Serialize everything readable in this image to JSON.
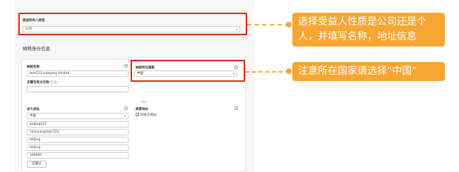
{
  "beneficial_owner": {
    "label": "受益所有人类型",
    "value": "公司"
  },
  "tax_section": {
    "title": "纳税身份信息"
  },
  "tax_form": {
    "name_label": "纳税名称",
    "name_value": "test123 company limited",
    "country_label": "纳税所在国家",
    "country_value": "中国",
    "english_name_label": "无需写英文名称",
    "english_name_hint": "(可选)",
    "address_section_label": "地址",
    "perm_address_label": "永久地址",
    "perm_country_value": "中国",
    "address_lines": [
      "beijing123",
      "chaoyangdajie123",
      "beijing",
      "beijing",
      "100000"
    ],
    "mailing_label": "邮寄地址",
    "mailing_checkbox_label": "同永久地址",
    "add_button_label": "已确认"
  },
  "callouts": {
    "first": "选择受益人性质是公司还是个人，并填写名称，地址信息",
    "second": "注意所在国家请选择“中国”"
  },
  "icons": {
    "info": "info-icon",
    "dropdown": "chevron-down-icon",
    "check": "check-icon"
  },
  "colors": {
    "highlight_red": "#e0221b",
    "callout_orange": "#f8a633",
    "info_blue": "#5aa0d8"
  }
}
